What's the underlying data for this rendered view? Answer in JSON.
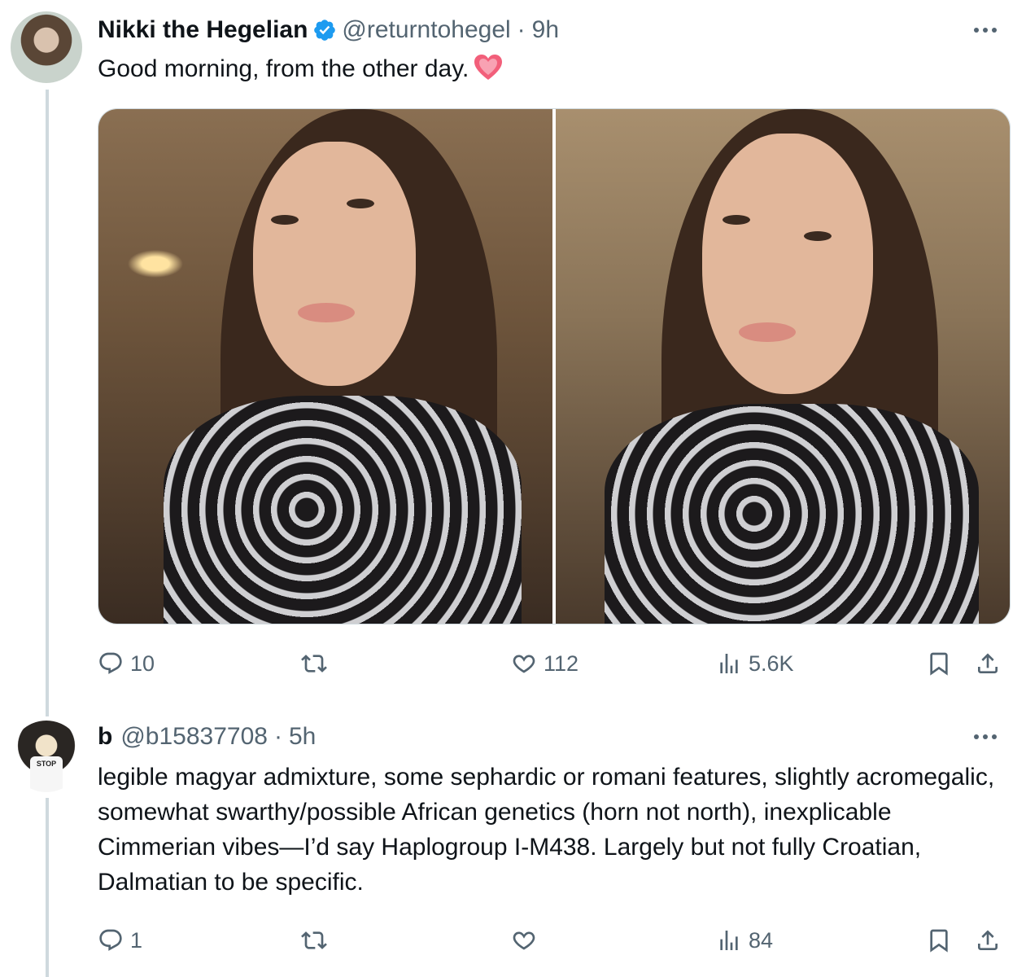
{
  "tweet1": {
    "name": "Nikki the Hegelian",
    "handle": "@returntohegel",
    "separator": "·",
    "time": "9h",
    "text": "Good morning, from the other day.",
    "replies": "10",
    "retweets": "",
    "likes": "112",
    "views": "5.6K"
  },
  "tweet2": {
    "name": "b",
    "handle": "@b15837708",
    "separator": "·",
    "time": "5h",
    "avatar_text": "STOP",
    "text": "legible magyar admixture, some sephardic or romani features, slightly acromegalic, somewhat swarthy/possible African genetics (horn not north), inexplicable Cimmerian vibes—I’d say Haplogroup I-M438. Largely but not fully Croatian, Dalmatian to be specific.",
    "replies": "1",
    "retweets": "",
    "likes": "",
    "views": "84"
  },
  "colors": {
    "verified": "#1d9bf0",
    "muted": "#536471",
    "thread_line": "#cfd9de",
    "heart_emoji": "#f25f7a"
  },
  "icons": [
    "reply-icon",
    "retweet-icon",
    "like-icon",
    "views-icon",
    "bookmark-icon",
    "share-icon",
    "more-icon",
    "verified-badge-icon",
    "heart-emoji-icon"
  ]
}
